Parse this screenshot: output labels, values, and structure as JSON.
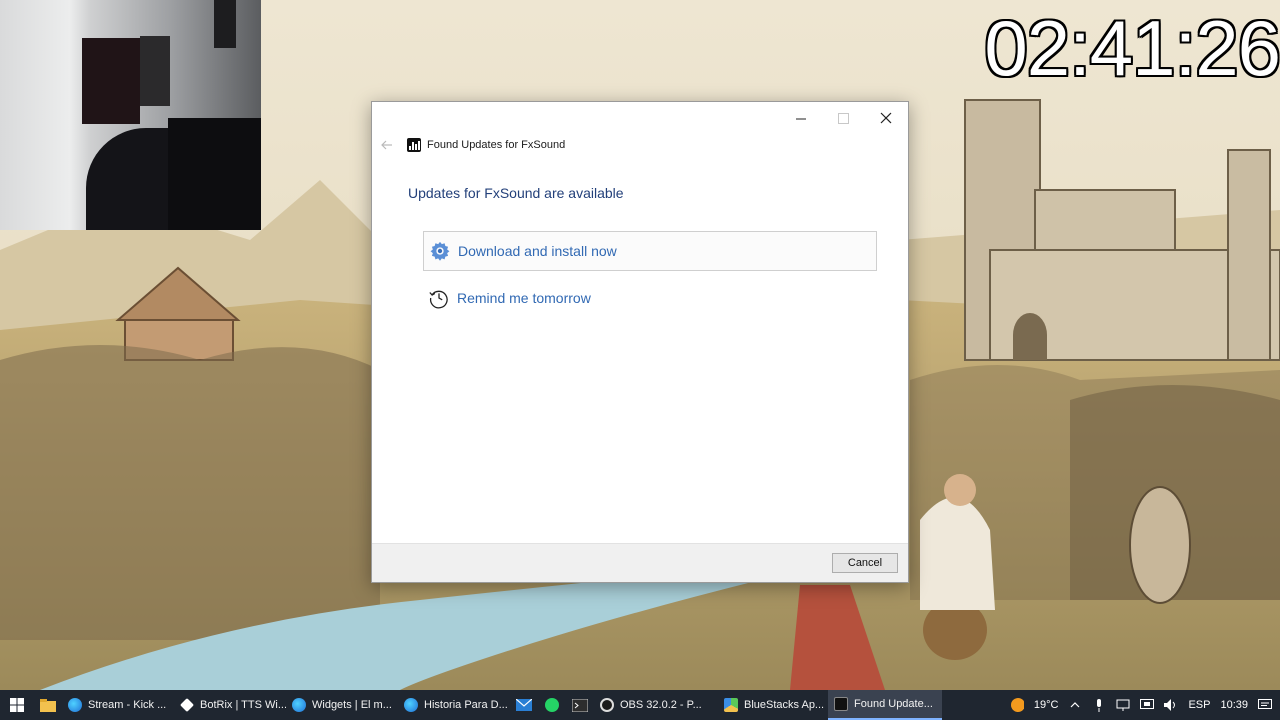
{
  "overlay": {
    "timer": "02:41:26"
  },
  "dialog": {
    "title": "Found Updates for FxSound",
    "main_instruction": "Updates for FxSound are available",
    "commands": [
      {
        "label": "Download and install now",
        "icon": "gear-icon"
      },
      {
        "label": "Remind me tomorrow",
        "icon": "history-clock-icon"
      }
    ],
    "cancel_label": "Cancel",
    "colors": {
      "instruction": "#23407a",
      "link": "#3169b3"
    }
  },
  "taskbar": {
    "apps": [
      {
        "label": "Stream - Kick ...",
        "icon": "edge-icon"
      },
      {
        "label": "BotRix | TTS Wi...",
        "icon": "botrix-icon"
      },
      {
        "label": "Widgets | El m...",
        "icon": "edge-icon"
      },
      {
        "label": "Historia Para D...",
        "icon": "edge-icon"
      },
      {
        "label": "OBS 32.0.2 - P...",
        "icon": "obs-icon"
      },
      {
        "label": "BlueStacks Ap...",
        "icon": "bluestacks-icon"
      },
      {
        "label": "Found Update...",
        "icon": "fxsound-icon"
      }
    ],
    "tray": {
      "temperature": "19°C",
      "language": "ESP",
      "time": "10:39"
    }
  }
}
